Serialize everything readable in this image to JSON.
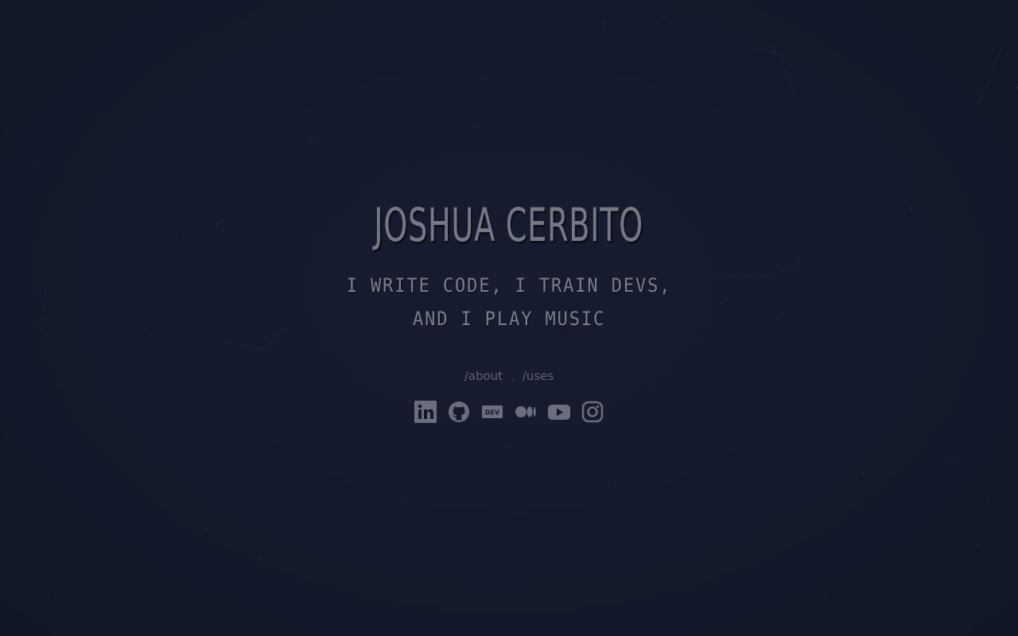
{
  "hero": {
    "name": "JOSHUA CERBITO",
    "tagline_line1": "I WRITE CODE, I TRAIN DEVS,",
    "tagline_line2": "AND I PLAY MUSIC"
  },
  "nav": {
    "about_label": "/about",
    "separator": ".",
    "uses_label": "/uses"
  },
  "socials": [
    {
      "name": "linkedin-icon",
      "label": "in"
    },
    {
      "name": "github-icon",
      "label": ""
    },
    {
      "name": "dev-icon",
      "label": "DEV"
    },
    {
      "name": "medium-icon",
      "label": ""
    },
    {
      "name": "youtube-icon",
      "label": ""
    },
    {
      "name": "instagram-icon",
      "label": ""
    }
  ],
  "colors": {
    "background": "#141a2b",
    "text": "#767985",
    "muted": "#5e6170",
    "icon": "#6b6e7b"
  }
}
